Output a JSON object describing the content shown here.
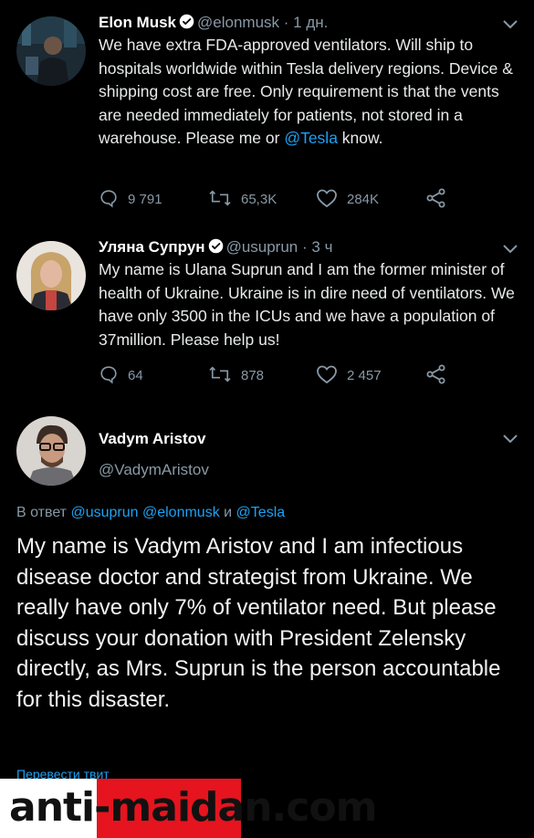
{
  "tweets": [
    {
      "name": "Elon Musk",
      "handle": "@elonmusk",
      "separator": "·",
      "time": "1 дн.",
      "text_before_link": "We have extra FDA-approved ventilators. Will ship to hospitals worldwide within Tesla delivery regions. Device & shipping cost are free. Only requirement is that the vents are needed immediately for patients, not stored in a warehouse. Please me or ",
      "link": "@Tesla",
      "text_after_link": " know.",
      "replies": "9 791",
      "retweets": "65,3K",
      "likes": "284K"
    },
    {
      "name": "Уляна Супрун",
      "handle": "@usuprun",
      "separator": "·",
      "time": "3 ч",
      "text": "My name is Ulana Suprun and I am the former minister of health of Ukraine. Ukraine is in dire need of ventilators. We have only 3500 in the ICUs and we have a population of  37million. Please help us!",
      "replies": "64",
      "retweets": "878",
      "likes": "2 457"
    }
  ],
  "main_tweet": {
    "name": "Vadym Aristov",
    "handle": "@VadymAristov",
    "reply_prefix": "В ответ",
    "reply_mentions": [
      "@usuprun",
      "@elonmusk"
    ],
    "reply_and": "и",
    "reply_last": "@Tesla",
    "text": "My name is Vadym Aristov and I am infectious disease doctor and strategist from Ukraine. We really have only 7% of ventilator need. But please discuss your donation with President Zelensky directly, as Mrs. Suprun is the person accountable for this disaster.",
    "translate": "Перевести твит"
  },
  "watermark": {
    "part1": "anti-",
    "part2": "maidan",
    "part3": ".com"
  },
  "colors": {
    "background": "#000000",
    "link": "#1da1f2",
    "secondary": "#8899a6",
    "watermark_red": "#e5141e"
  }
}
